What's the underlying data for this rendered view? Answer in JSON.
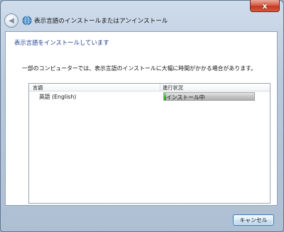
{
  "window": {
    "title": "表示言語のインストールまたはアンインストール",
    "close_label": "x"
  },
  "page": {
    "heading": "表示言語をインストールしています",
    "description": "一部のコンピューターでは、表示言語のインストールに大幅に時間がかかる場合があります。"
  },
  "list": {
    "columns": [
      "言語",
      "進行状況"
    ],
    "rows": [
      {
        "language": "英語 (English)",
        "status": "インストール中",
        "progress": 0.02
      }
    ]
  },
  "footer": {
    "cancel_label": "キャンセル"
  },
  "colors": {
    "heading": "#1d3e8a",
    "progress_fill": "#35b22f",
    "close_button": "#c23a22"
  },
  "icons": {
    "back": "back-arrow-icon",
    "app": "language-globe-icon",
    "close": "close-icon"
  }
}
